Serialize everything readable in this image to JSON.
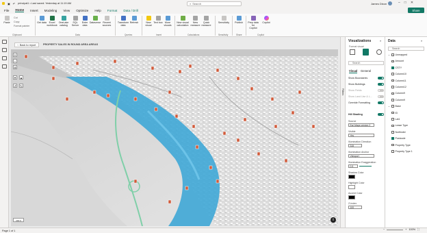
{
  "titlebar": {
    "file_title": "principal1 • Last saved: Yesterday at 11:19 AM",
    "search_placeholder": "Search",
    "user_name": "James Dixon"
  },
  "menu": {
    "items": [
      "File",
      "Home",
      "Insert",
      "Modeling",
      "View",
      "Optimize",
      "Help"
    ],
    "context_tools": [
      "Format",
      "Data / Drill"
    ],
    "active": "Home",
    "share_label": "Share"
  },
  "ribbon": {
    "clipboard": {
      "paste": "Paste",
      "cut": "Cut",
      "copy": "Copy",
      "format_painter": "Format painter",
      "group": "Clipboard"
    },
    "data": {
      "buttons": [
        "Get data",
        "Excel workbook",
        "OneLake catalog",
        "SQL Server",
        "Enter data",
        "Dataverse",
        "Recent sources"
      ],
      "group": "Data"
    },
    "queries": {
      "buttons": [
        "Transform data",
        "Refresh"
      ],
      "group": "Queries"
    },
    "insert": {
      "buttons": [
        "New visual",
        "Text box",
        "More visuals"
      ],
      "group": "Insert"
    },
    "calculations": {
      "buttons": [
        "New visual calculation",
        "New measure",
        "Quick measure"
      ],
      "group": "Calculations"
    },
    "sensitivity": {
      "buttons": [
        "Sensitivity"
      ],
      "group": "Sensitivity"
    },
    "share": {
      "buttons": [
        "Publish"
      ],
      "group": "Share"
    },
    "copilot": {
      "buttons": [
        "Prep data for Copilot",
        "Copilot"
      ],
      "group": "Copilot"
    }
  },
  "canvas": {
    "back_label": "Back to report",
    "report_title": "PROPERTY SALES IN ROUND AREA AREAS",
    "scale_label": "200 ft",
    "info_label": "i"
  },
  "filters_tab": "Filters",
  "viz_pane": {
    "title": "Visualizations",
    "format_label": "Format visual",
    "search_placeholder": "Search",
    "tabs": [
      "Visual",
      "General"
    ],
    "toggles": [
      {
        "label": "Show Boundaries",
        "on": true
      },
      {
        "label": "Show Buildings",
        "on": true
      },
      {
        "label": "Show Fields",
        "on": false
      },
      {
        "label": "Show Land Use & L...",
        "on": false
      },
      {
        "label": "Override Formatting",
        "on": true
      }
    ],
    "section": "Hill Shading",
    "fields": [
      {
        "label": "Source",
        "value": "Esri Maps version 2"
      },
      {
        "label": "Visible",
        "value": "Yes"
      },
      {
        "label": "Illumination Direction",
        "value": "315"
      },
      {
        "label": "Illumination Anchor",
        "value": "Viewport"
      },
      {
        "label": "Illumination Exaggeration",
        "value": "0.5"
      },
      {
        "label": "Shadow Color",
        "value": ""
      },
      {
        "label": "Highlight Color",
        "value": ""
      },
      {
        "label": "Accent Color",
        "value": ""
      },
      {
        "label": "Z-Index",
        "value": "100"
      }
    ]
  },
  "data_pane": {
    "title": "Data",
    "search_placeholder": "Search",
    "items": [
      {
        "label": "Unmapped",
        "level": 0,
        "checked": false
      },
      {
        "label": "Amount",
        "level": 1,
        "checked": false
      },
      {
        "label": "CSTY",
        "level": 1,
        "checked": true
      },
      {
        "label": "Column10",
        "level": 1,
        "checked": false
      },
      {
        "label": "Column11",
        "level": 1,
        "checked": false
      },
      {
        "label": "Column12",
        "level": 1,
        "checked": false
      },
      {
        "label": "Column9",
        "level": 1,
        "checked": false
      },
      {
        "label": "Column9",
        "level": 1,
        "checked": false
      },
      {
        "label": "Base",
        "level": 0,
        "checked": false
      },
      {
        "label": "ID",
        "level": 1,
        "checked": false
      },
      {
        "label": "Lat1",
        "level": 1,
        "checked": false
      },
      {
        "label": "Lease Type",
        "level": 1,
        "checked": false
      },
      {
        "label": "Northwild",
        "level": 1,
        "checked": false
      },
      {
        "label": "Postcode",
        "level": 1,
        "checked": true
      },
      {
        "label": "Property Type",
        "level": 1,
        "checked": false
      },
      {
        "label": "Property Type 1",
        "level": 1,
        "checked": false
      }
    ]
  },
  "status": {
    "page": "Page 1 of 1",
    "zoom": "100%"
  },
  "colors": {
    "accent": "#117865",
    "river": "#3fa7d6",
    "road": "#7fcfa8",
    "marker": "#d05a3a"
  }
}
